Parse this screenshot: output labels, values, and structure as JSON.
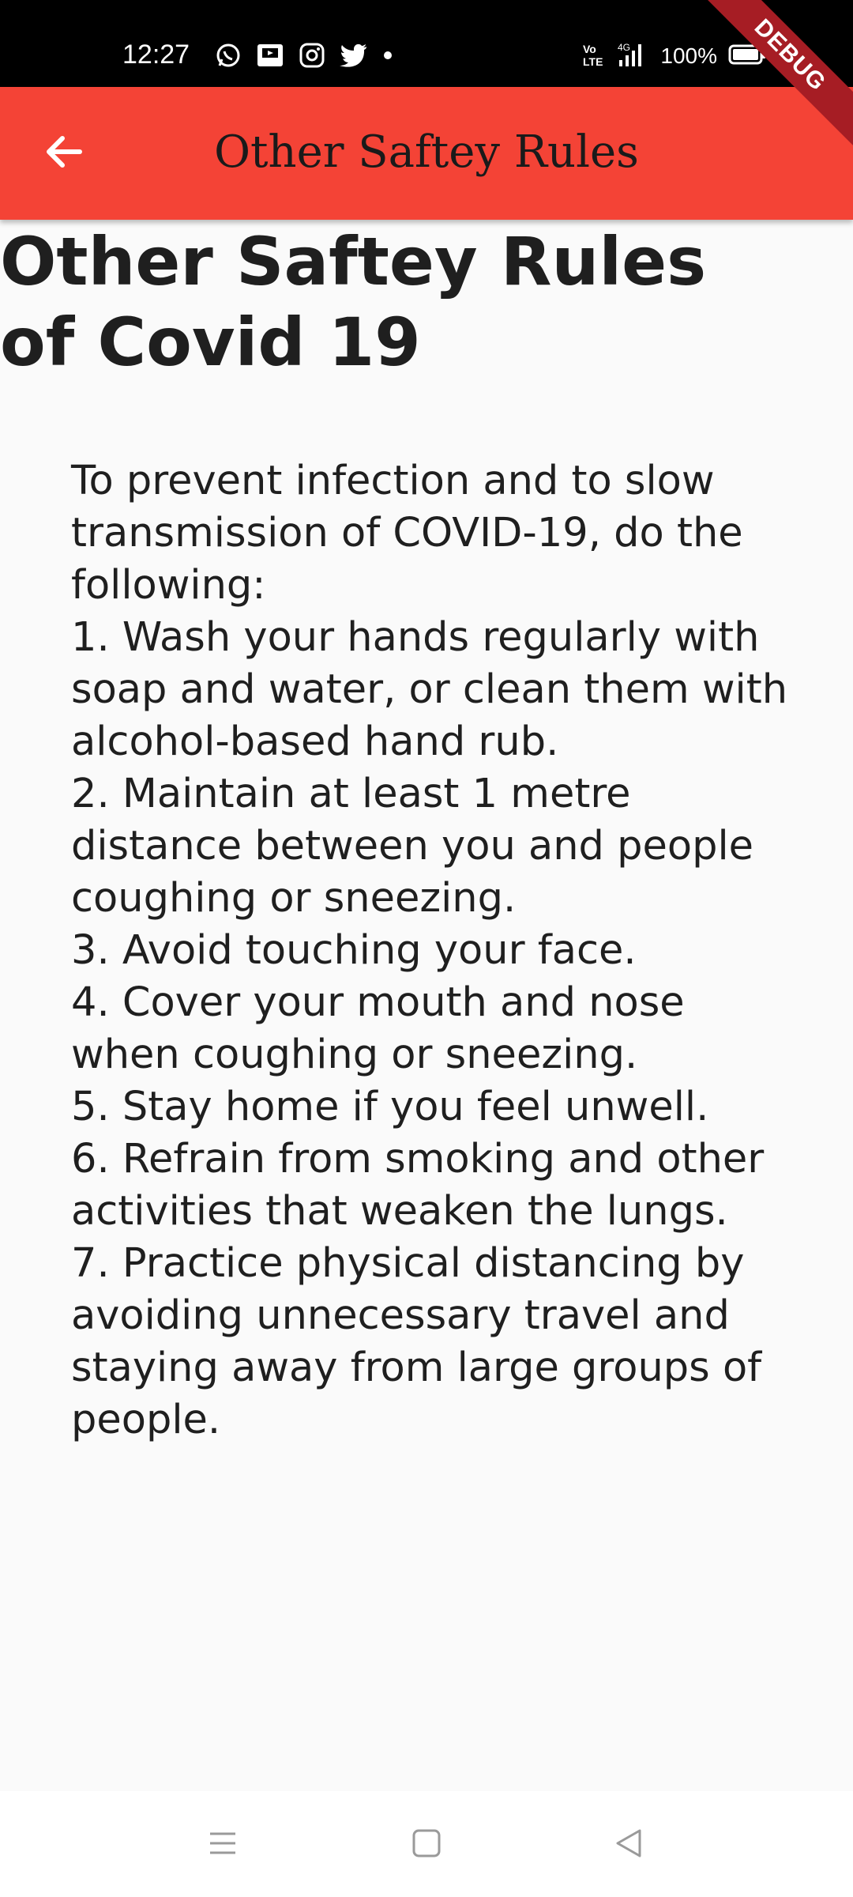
{
  "status_bar": {
    "time": "12:27",
    "battery": "100%",
    "network": "4G",
    "icons_left": [
      "whatsapp-icon",
      "media-icon",
      "instagram-icon",
      "twitter-icon",
      "dot-icon"
    ],
    "icons_right": [
      "volte-icon",
      "signal-icon",
      "battery-icon"
    ]
  },
  "debug_banner": "DEBUG",
  "app_bar": {
    "title": "Other Saftey Rules",
    "back_icon": "arrow-back-icon",
    "color": "#f44336"
  },
  "content": {
    "heading": "Other Saftey Rules of Covid 19",
    "intro": "To prevent infection and to slow transmission of COVID-19, do the following:",
    "rules": [
      "1. Wash your hands regularly with soap and water, or clean them with alcohol-based hand rub.",
      "2. Maintain at least 1 metre distance between you and people coughing or sneezing.",
      "3. Avoid touching your face.",
      "4. Cover your mouth and nose when coughing or sneezing.",
      "5. Stay home if you feel unwell.",
      "6. Refrain from smoking and other activities that weaken the lungs.",
      "7. Practice physical distancing by avoiding unnecessary travel and staying away from large groups of people."
    ]
  },
  "nav_bar": {
    "buttons": [
      "menu-icon",
      "home-icon",
      "back-icon"
    ]
  }
}
